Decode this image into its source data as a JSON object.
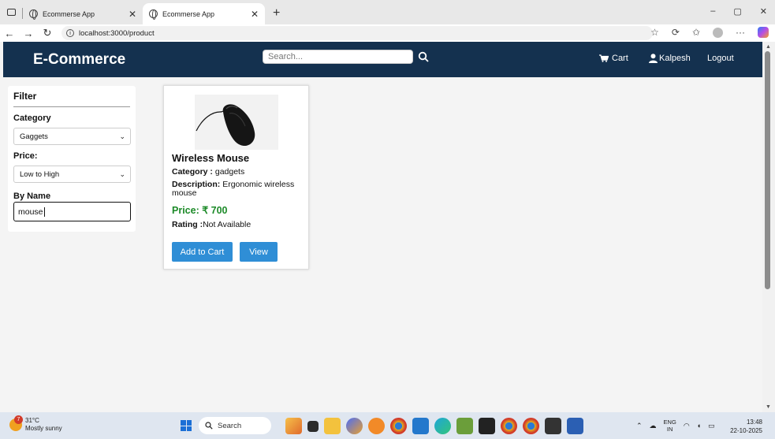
{
  "browser": {
    "tabs": [
      {
        "title": "Ecommerse App",
        "active": false
      },
      {
        "title": "Ecommerse App",
        "active": true
      }
    ],
    "new_tab": "+",
    "url": "localhost:3000/product",
    "window_controls": {
      "minimize": "–",
      "restore": "▢",
      "close": "✕"
    }
  },
  "navbar": {
    "brand": "E-Commerce",
    "search_placeholder": "Search...",
    "cart": "Cart",
    "user": "Kalpesh",
    "logout": "Logout"
  },
  "filter": {
    "title": "Filter",
    "category_label": "Category",
    "category_value": "Gaggets",
    "price_label": "Price:",
    "price_value": "Low to High",
    "name_label": "By Name",
    "name_value": "mouse"
  },
  "product": {
    "name": "Wireless Mouse",
    "category_label": "Category :",
    "category": "gadgets",
    "description_label": "Description:",
    "description": "Ergonomic wireless mouse",
    "price": "Price: ₹ 700",
    "rating_label": "Rating :",
    "rating": "Not Available",
    "add_to_cart": "Add to Cart",
    "view": "View"
  },
  "taskbar": {
    "temperature": "31°C",
    "weather": "Mostly sunny",
    "weather_badge": "7",
    "search": "Search",
    "lang_top": "ENG",
    "lang_bottom": "IN",
    "time": "13:48",
    "date": "22-10-2025"
  },
  "colors": {
    "navbar": "#14314f",
    "button": "#2f8ed6",
    "price": "#1c8a28"
  }
}
